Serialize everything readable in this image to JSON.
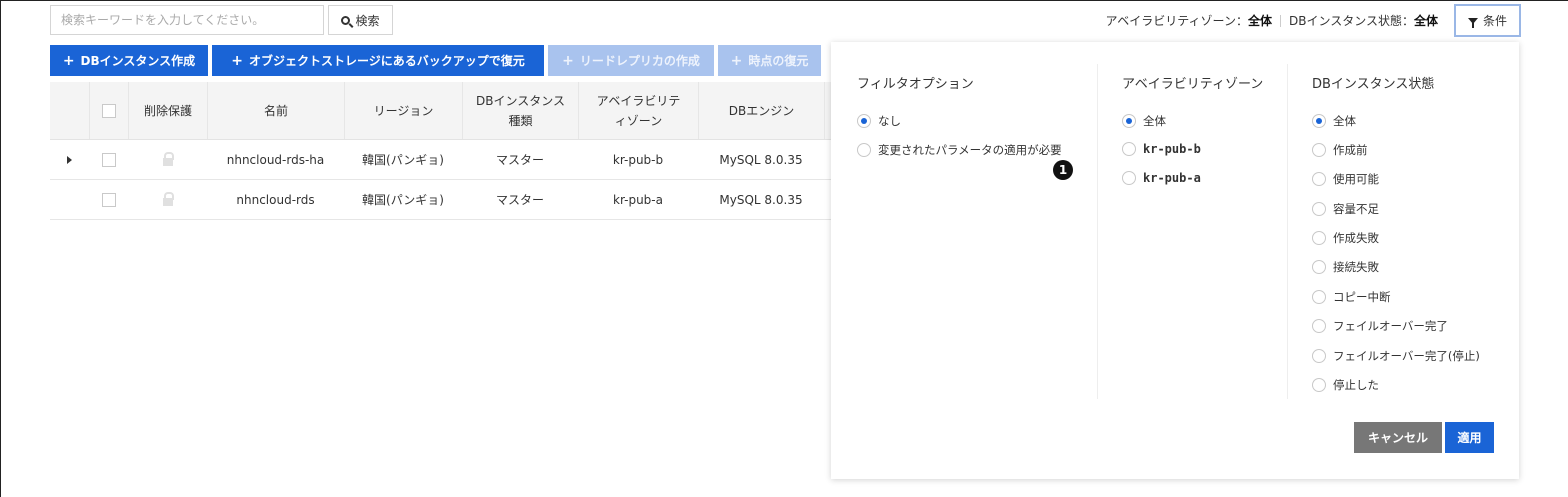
{
  "search": {
    "placeholder": "検索キーワードを入力してください。",
    "button_label": "検索"
  },
  "status": {
    "az_label": "アベイラビリティゾーン：",
    "az_value": "全体",
    "db_state_label": "DBインスタンス状態：",
    "db_state_value": "全体"
  },
  "condition_button": "条件",
  "toolbar": {
    "create": "DBインスタンス作成",
    "restore_object_storage": "オブジェクトストレージにあるバックアップで復元",
    "create_read_replica": "リードレプリカの作成",
    "point_in_time_restore": "時点の復元"
  },
  "table": {
    "headers": {
      "delete_protection": "削除保護",
      "name": "名前",
      "region": "リージョン",
      "instance_type_1": "DBインスタンス",
      "instance_type_2": "種類",
      "az_1": "アベイラビリテ",
      "az_2": "ィゾーン",
      "engine": "DBエンジン"
    },
    "rows": [
      {
        "name": "nhncloud-rds-ha",
        "region": "韓国(パンギョ)",
        "type": "マスター",
        "az": "kr-pub-b",
        "engine": "MySQL 8.0.35"
      },
      {
        "name": "nhncloud-rds",
        "region": "韓国(パンギョ)",
        "type": "マスター",
        "az": "kr-pub-a",
        "engine": "MySQL 8.0.35"
      }
    ]
  },
  "filter_panel": {
    "filter_options": {
      "title": "フィルタオプション",
      "items": [
        "なし",
        "変更されたパラメータの適用が必要"
      ],
      "selected": 0
    },
    "availability_zone": {
      "title": "アベイラビリティゾーン",
      "items": [
        "全体",
        "kr-pub-b",
        "kr-pub-a"
      ],
      "selected": 0
    },
    "db_instance_state": {
      "title": "DBインスタンス状態",
      "items": [
        "全体",
        "作成前",
        "使用可能",
        "容量不足",
        "作成失敗",
        "接続失敗",
        "コピー中断",
        "フェイルオーバー完了",
        "フェイルオーバー完了(停止)",
        "停止した"
      ],
      "selected": 0
    },
    "annotation_badge": "1",
    "cancel_label": "キャンセル",
    "apply_label": "適用"
  },
  "colors": {
    "primary": "#1a64d6",
    "disabled": "#a9c3ee",
    "cancel": "#777777"
  }
}
